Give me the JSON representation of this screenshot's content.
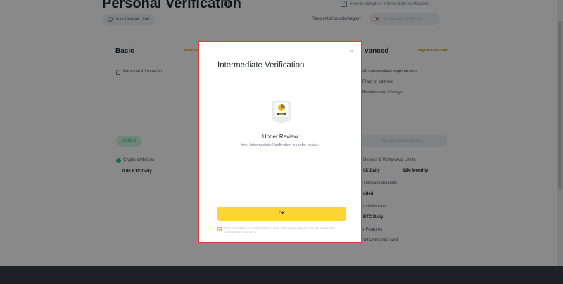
{
  "page": {
    "title": "Personal Verification",
    "how_to_link": "How to complete Intermediate Verification",
    "current_limit_label": "Your Current Limit",
    "region_label": "Residential country/region:",
    "region_value": "South Korea (대한민국)"
  },
  "basic": {
    "title": "Basic",
    "link": "Quick A",
    "requirement": "Personal Information",
    "status": "Verified",
    "crypto_withdraw_label": "Crypto Withdraw",
    "crypto_withdraw_value": "0.06 BTC Daily"
  },
  "advanced": {
    "title": "vanced",
    "link": "Higher Fiat Limit",
    "requirements": [
      "All Intermediate requirements",
      "Proof of address",
      "Review time: 10 days"
    ],
    "request_button": "Request Intermediate",
    "deposit_label": "Deposit & Withdrawal Limits",
    "deposit_daily": "0K Daily",
    "deposit_monthly": "$2M Monthly",
    "transaction_label": "Transaction Limits",
    "transaction_value": "nited",
    "withdraw_label": "to Withdraw",
    "withdraw_value": "BTC Daily",
    "features_label": "r Features",
    "features_value": "OTC/Binance card"
  },
  "modal": {
    "title": "Intermediate Verification",
    "close_symbol": "×",
    "status_title": "Under Review",
    "status_text": "Your Intermediate Verification is under review.",
    "ok_label": "OK",
    "disclaimer": "This information is used for Intermediate Verification only, and is kept private and confidential by Binance."
  },
  "colors": {
    "accent": "#fcd535",
    "highlight_border": "#e53935",
    "verified": "#2ebd85"
  }
}
